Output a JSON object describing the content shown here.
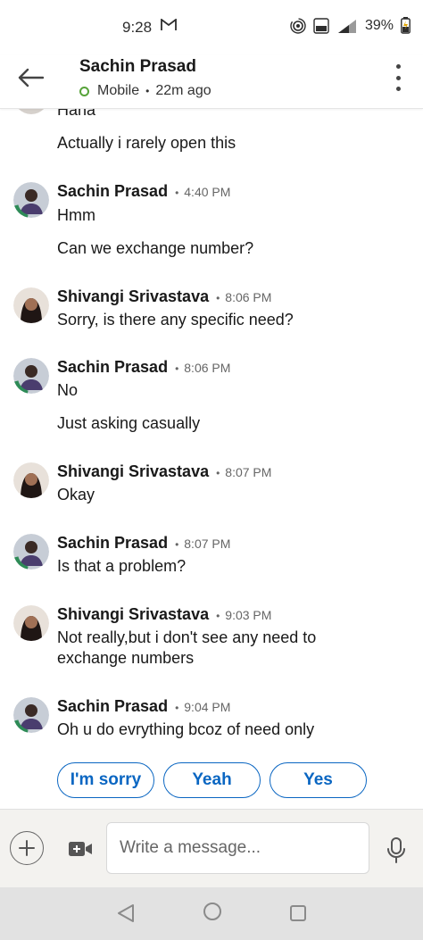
{
  "status_bar": {
    "time": "9:28",
    "mail_icon": "gmail-icon",
    "battery_percent": "39%"
  },
  "header": {
    "contact_name": "Sachin Prasad",
    "presence": "Mobile",
    "separator": "•",
    "last_active": "22m ago"
  },
  "messages": [
    {
      "sender": "",
      "time": "",
      "lines": [
        "Haha",
        "Actually i rarely open this"
      ]
    },
    {
      "sender": "Sachin Prasad",
      "time": "4:40 PM",
      "lines": [
        "Hmm",
        "Can we exchange number?"
      ]
    },
    {
      "sender": "Shivangi Srivastava",
      "time": "8:06 PM",
      "lines": [
        "Sorry, is there any specific need?"
      ]
    },
    {
      "sender": "Sachin Prasad",
      "time": "8:06 PM",
      "lines": [
        "No",
        "Just asking casually"
      ]
    },
    {
      "sender": "Shivangi Srivastava",
      "time": "8:07 PM",
      "lines": [
        "Okay"
      ]
    },
    {
      "sender": "Sachin Prasad",
      "time": "8:07 PM",
      "lines": [
        "Is that a problem?"
      ]
    },
    {
      "sender": "Shivangi Srivastava",
      "time": "9:03 PM",
      "lines": [
        "Not really,but i don't see any need to",
        "exchange numbers"
      ]
    },
    {
      "sender": "Sachin Prasad",
      "time": "9:04 PM",
      "lines": [
        "Oh u do evrything bcoz of need only"
      ]
    }
  ],
  "suggestions": [
    "I'm sorry",
    "Yeah",
    "Yes"
  ],
  "compose": {
    "placeholder": "Write a message..."
  },
  "colors": {
    "accent": "#0a66c2",
    "online": "#57a33a"
  }
}
